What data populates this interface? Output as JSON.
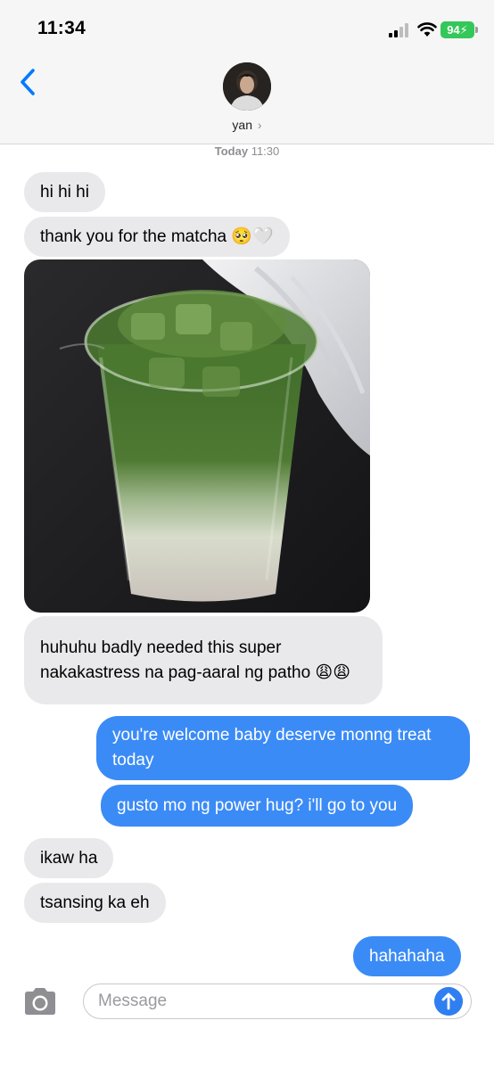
{
  "status_bar": {
    "time": "11:34",
    "battery": "94"
  },
  "header": {
    "contact_name": "yan",
    "chevron": "›"
  },
  "thread": {
    "timestamp_day": "Today",
    "timestamp_time": "11:30",
    "messages": [
      {
        "from": "them",
        "text": "hi hi hi"
      },
      {
        "from": "them",
        "text": "thank you for the matcha 🥺🤍"
      },
      {
        "from": "them",
        "type": "photo",
        "alt": "iced matcha latte"
      },
      {
        "from": "them",
        "text": "huhuhu badly needed this super nakakastress na pag-aaral ng patho 😩😩"
      },
      {
        "from": "me",
        "text": "you're welcome baby deserve monng treat today"
      },
      {
        "from": "me",
        "text": "gusto mo ng power hug? i'll go to you"
      },
      {
        "from": "them",
        "text": "ikaw ha"
      },
      {
        "from": "them",
        "text": "tsansing ka eh"
      },
      {
        "from": "me",
        "text": "hahahaha"
      }
    ]
  },
  "composer": {
    "placeholder": "Message"
  },
  "icons": {
    "back": "chevron-left-icon",
    "camera": "camera-icon",
    "send": "arrow-up-icon",
    "signal": "signal-icon",
    "wifi": "wifi-icon"
  },
  "colors": {
    "accent": "#007aff",
    "outgoing_bubble": "#3b8bf6",
    "incoming_bubble": "#e9e9eb",
    "battery": "#34c759"
  }
}
